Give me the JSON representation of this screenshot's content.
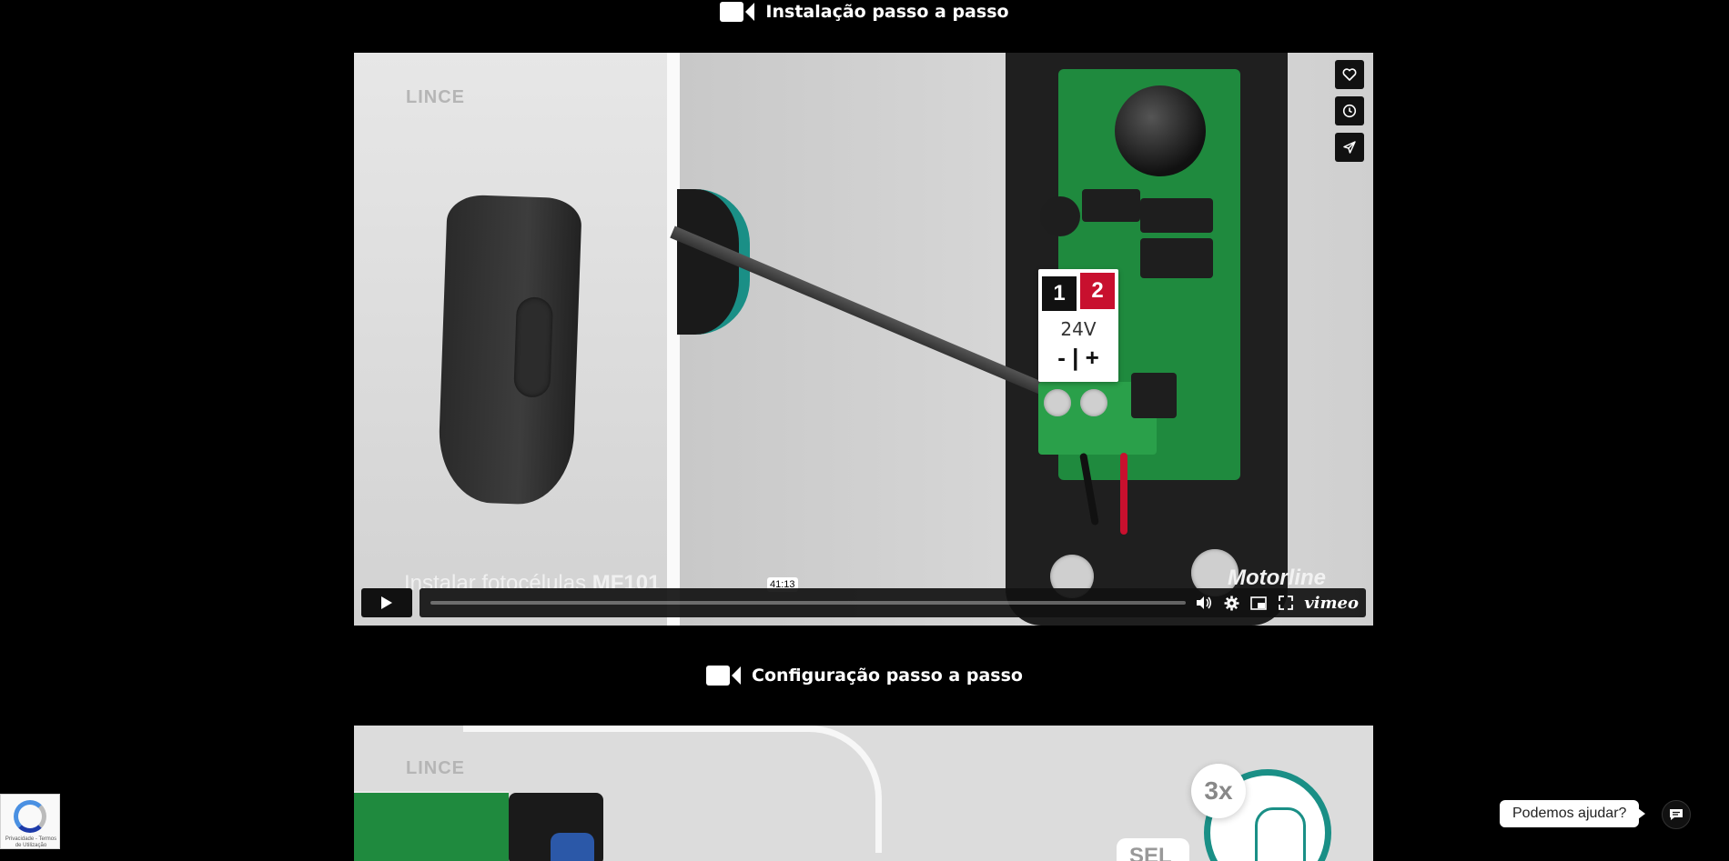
{
  "sections": [
    {
      "title": "Instalação passo a passo"
    },
    {
      "title": "Configuração passo a passo"
    }
  ],
  "video1": {
    "watermark": "LINCE",
    "label_card": {
      "n1": "1",
      "n2": "2",
      "volts": "24V",
      "pm": "- | +"
    },
    "brand": "Motorline",
    "caption_prefix": "Instalar fotocélulas",
    "caption_model": "MF101",
    "time_tooltip": "41:13",
    "side_buttons": [
      "heart-icon",
      "clock-icon",
      "share-icon"
    ],
    "controls": {
      "vimeo": "vimeo"
    }
  },
  "video2": {
    "watermark": "LINCE",
    "bubble": "3x",
    "tag": "SEL"
  },
  "recaptcha": {
    "legal": "Privacidade - Termos de Utilização"
  },
  "help": {
    "chip": "Podemos ajudar?"
  },
  "colors": {
    "accent_teal": "#1a8f86",
    "pcb_green": "#1f8a3e",
    "label_red": "#c8102e",
    "background": "#000000"
  }
}
